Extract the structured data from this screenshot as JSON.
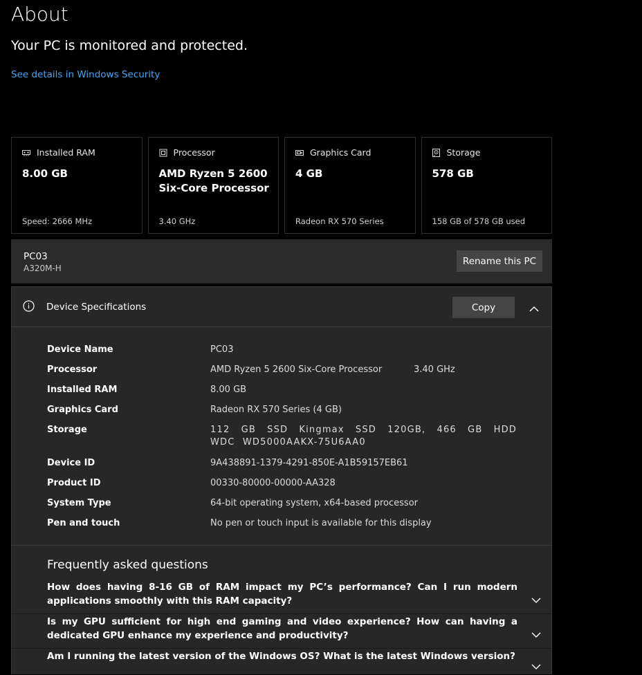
{
  "header": {
    "title": "About",
    "status": "Your PC is monitored and protected.",
    "security_link": "See details in Windows Security"
  },
  "cards": [
    {
      "icon": "ram-icon",
      "label": "Installed RAM",
      "value": "8.00 GB",
      "sub": "Speed: 2666 MHz"
    },
    {
      "icon": "processor-icon",
      "label": "Processor",
      "value": "AMD Ryzen 5 2600 Six-Core Processor",
      "sub": "3.40 GHz"
    },
    {
      "icon": "graphics-card-icon",
      "label": "Graphics Card",
      "value": "4 GB",
      "sub": "Radeon RX 570 Series"
    },
    {
      "icon": "storage-icon",
      "label": "Storage",
      "value": "578 GB",
      "sub": "158 GB of 578 GB used"
    }
  ],
  "pc": {
    "name": "PC03",
    "model": "A320M-H",
    "rename_label": "Rename this PC"
  },
  "specs": {
    "title": "Device Specifications",
    "copy_label": "Copy",
    "rows": [
      {
        "label": "Device Name",
        "value": "PC03"
      },
      {
        "label": "Processor",
        "value": "AMD Ryzen 5 2600 Six-Core Processor",
        "extra": "3.40 GHz"
      },
      {
        "label": "Installed RAM",
        "value": "8.00 GB"
      },
      {
        "label": "Graphics Card",
        "value": "Radeon RX 570 Series (4 GB)"
      },
      {
        "label": "Storage",
        "value": "112 GB SSD Kingmax SSD 120GB, 466 GB HDD WDC WD5000AAKX-75U6AA0"
      },
      {
        "label": "Device ID",
        "value": "9A438891-1379-4291-850E-A1B59157EB61"
      },
      {
        "label": "Product ID",
        "value": "00330-80000-00000-AA328"
      },
      {
        "label": "System Type",
        "value": "64-bit operating system, x64-based processor"
      },
      {
        "label": "Pen and touch",
        "value": "No pen or touch input is available for this display"
      }
    ]
  },
  "faq": {
    "title": "Frequently asked questions",
    "items": [
      "How does having 8-16 GB of RAM impact my PC’s performance? Can I run modern applications smoothly with this RAM capacity?",
      "Is my GPU sufficient for high end gaming and video experience? How can having a dedicated GPU enhance my experience and productivity?",
      "Am I running the latest version of the Windows OS? What is the latest Windows version?"
    ]
  },
  "colors": {
    "background": "#000000",
    "panel": "#272727",
    "link": "#4aa3f0",
    "button": "#454545"
  }
}
